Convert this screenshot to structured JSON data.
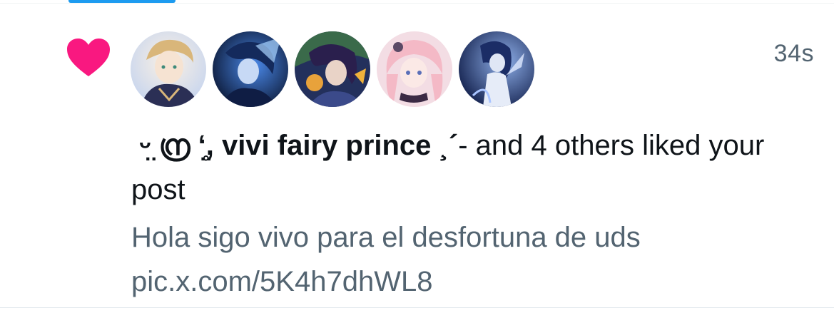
{
  "notification": {
    "type_icon": "heart-icon",
    "accent_color": "#f91880",
    "timestamp": "34s",
    "avatars": [
      {
        "name": "avatar-1",
        "colors": [
          "#f3e6d8",
          "#d9b67a",
          "#8a9bc4"
        ]
      },
      {
        "name": "avatar-2",
        "colors": [
          "#0d1b3e",
          "#2f6fd1",
          "#a9d4ff"
        ]
      },
      {
        "name": "avatar-3",
        "colors": [
          "#1f2a4d",
          "#3b4a8a",
          "#e8a23b"
        ]
      },
      {
        "name": "avatar-4",
        "colors": [
          "#f7dfe6",
          "#e8a7b8",
          "#5b4a66"
        ]
      },
      {
        "name": "avatar-5",
        "colors": [
          "#13224f",
          "#6f8fd6",
          "#dfe9ff"
        ]
      }
    ],
    "user_name": " ᵕ̤ ന്ര ʻ̤̥, vivi fairy prince ¸´",
    "liked_suffix": "- and 4 others liked your post",
    "post_line_1": "Hola sigo vivo para el desfortuna de uds",
    "post_line_2": "pic.x.com/5K4h7dhWL8"
  }
}
